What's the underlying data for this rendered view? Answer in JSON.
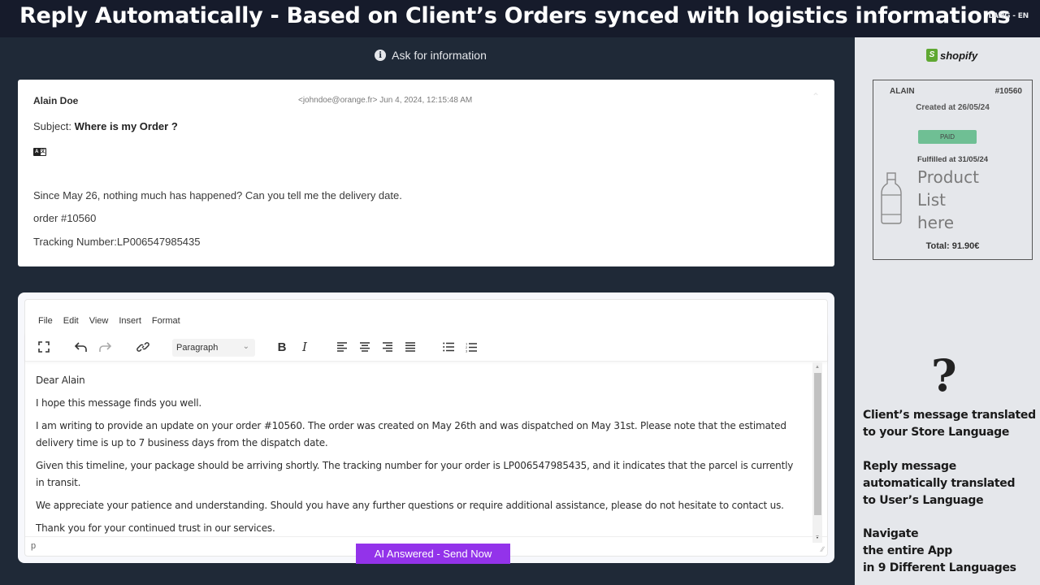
{
  "banner": {
    "title": "Reply Automatically - Based on Client’s Orders synced with logistics informations",
    "lang": "LANG - EN"
  },
  "main": {
    "ask_info": "Ask for information",
    "email": {
      "sender": "Alain Doe",
      "meta": "<johndoe@orange.fr> Jun 4, 2024, 12:15:48 AM",
      "subject_label": "Subject:",
      "subject": "Where is my Order ?",
      "translate_icon": "translate-icon",
      "body": [
        "Since May 26, nothing much has happened? Can you tell me the delivery date.",
        "order #10560",
        "Tracking Number:LP006547985435"
      ]
    },
    "editor": {
      "menu": [
        "File",
        "Edit",
        "View",
        "Insert",
        "Format"
      ],
      "block_format": "Paragraph",
      "paragraphs": [
        "Dear Alain",
        "I hope this message finds you well.",
        "I am writing to provide an update on your order #10560. The order was created on May 26th and was dispatched on May 31st. Please note that the estimated delivery time is up to 7 business days from the dispatch date.",
        "Given this timeline, your package should be arriving shortly. The tracking number for your order is LP006547985435, and it indicates that the parcel is currently in transit.",
        "We appreciate your patience and understanding. Should you have any further questions or require additional assistance, please do not hesitate to contact us.",
        "Thank you for your continued trust in our services."
      ],
      "status_path": "p",
      "send_label": "AI Answered - Send Now"
    }
  },
  "sidebar": {
    "brand": "shopify",
    "order": {
      "customer": "ALAIN",
      "number": "#10560",
      "created": "Created at 26/05/24",
      "status": "PAID",
      "fulfilled": "Fulfilled at 31/05/24",
      "product_placeholder": "Product\nList\nhere",
      "total": "Total: 91.90€"
    },
    "features": [
      "Client’s message translated\nto your Store Language",
      "Reply message\nautomatically translated\nto User’s Language",
      "Navigate\nthe entire App\nin 9 Different Languages"
    ]
  },
  "colors": {
    "banner_bg": "#161b2b",
    "page_bg": "#1f2937",
    "sidebar_bg": "#e5e7eb",
    "send_button": "#9333ea",
    "paid_badge": "#6fbf94",
    "shopify_green": "#5fa832"
  }
}
